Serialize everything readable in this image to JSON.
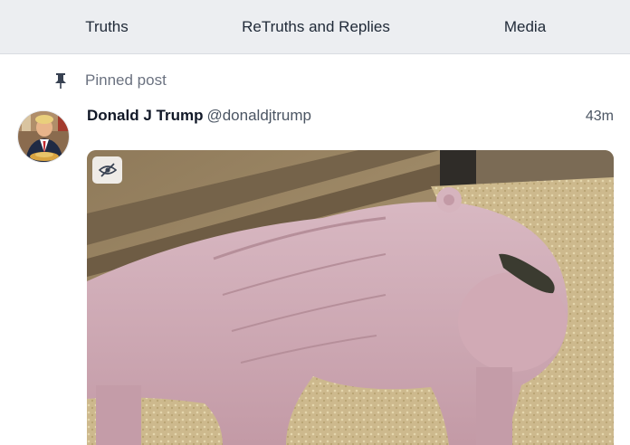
{
  "tabs": [
    {
      "label": "Truths"
    },
    {
      "label": "ReTruths and Replies"
    },
    {
      "label": "Media"
    }
  ],
  "pinned": {
    "label": "Pinned post",
    "icon": "pin-icon"
  },
  "post": {
    "author_name": "Donald J Trump",
    "handle": "@donaldjtrump",
    "time": "43m",
    "avatar_icon": "avatar-photo",
    "media_alt_icon": "eye-slash-icon"
  },
  "colors": {
    "tab_bar_bg": "#eceef1",
    "muted_text": "#6b7280"
  }
}
